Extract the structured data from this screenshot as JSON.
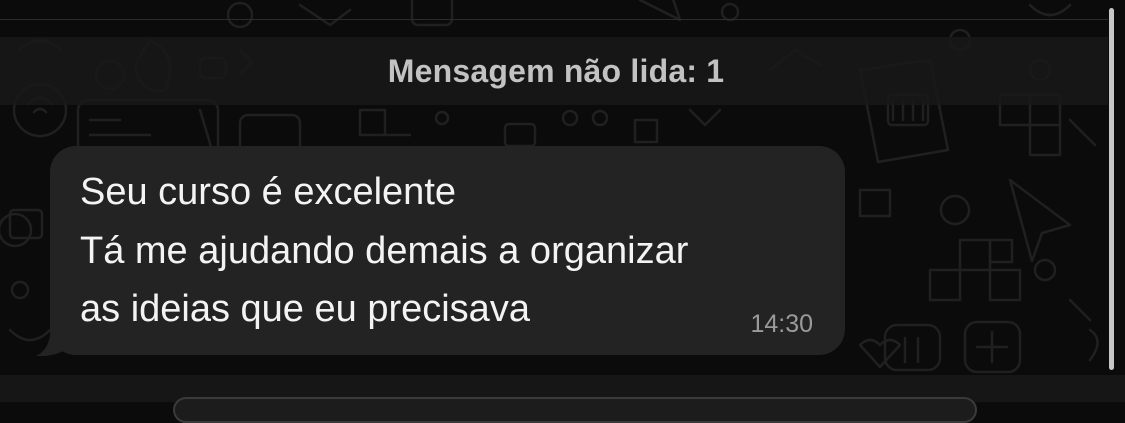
{
  "unread": {
    "label": "Mensagem não lida: 1"
  },
  "message": {
    "lines": [
      "Seu curso é excelente",
      "Tá me ajudando demais a organizar",
      "as ideias que eu precisava"
    ],
    "time": "14:30",
    "bubble_color": "#232323",
    "text_color": "#f3f3f3"
  },
  "colors": {
    "background": "#0b0b0b",
    "banner": "#181818",
    "timestamp": "#9a9a9a"
  }
}
